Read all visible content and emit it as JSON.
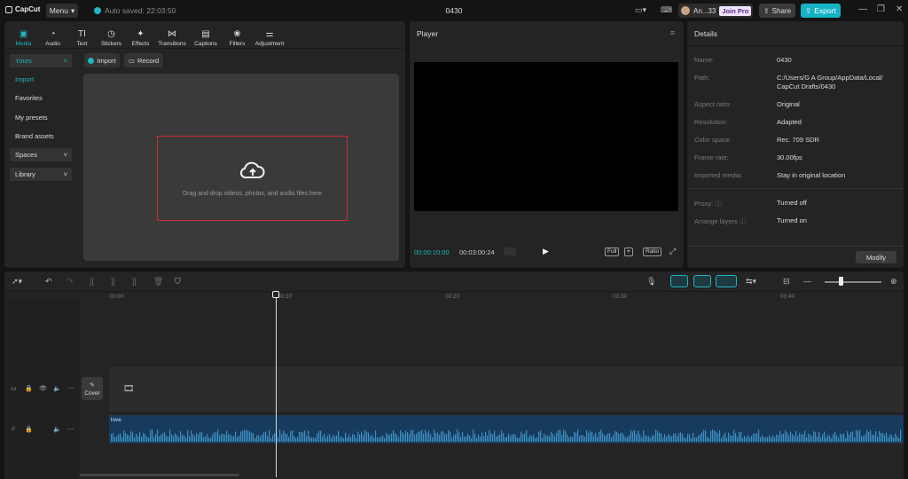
{
  "titlebar": {
    "app_name": "CapCut",
    "menu_label": "Menu",
    "autosave_text": "Auto saved: 22:03:50",
    "project_title": "0430",
    "user_name": "An...33",
    "join_pro": "Join Pro",
    "share_label": "Share",
    "export_label": "Export"
  },
  "media_tabs": [
    {
      "label": "Media",
      "icon": "media-icon"
    },
    {
      "label": "Audio",
      "icon": "audio-icon"
    },
    {
      "label": "Text",
      "icon": "text-icon"
    },
    {
      "label": "Stickers",
      "icon": "stickers-icon"
    },
    {
      "label": "Effects",
      "icon": "effects-icon"
    },
    {
      "label": "Transitions",
      "icon": "transitions-icon"
    },
    {
      "label": "Captions",
      "icon": "captions-icon"
    },
    {
      "label": "Filters",
      "icon": "filters-icon"
    },
    {
      "label": "Adjustment",
      "icon": "adjustment-icon"
    }
  ],
  "sidebar": {
    "yours": "Yours",
    "import": "Import",
    "favorites": "Favorites",
    "my_presets": "My presets",
    "brand_assets": "Brand assets",
    "spaces": "Spaces",
    "library": "Library"
  },
  "media": {
    "import_label": "Import",
    "record_label": "Record",
    "dropzone_text": "Drag and drop videos, photos, and audio files here"
  },
  "player": {
    "title": "Player",
    "current_time": "00:00:10:00",
    "total_time": "00:03:00:24",
    "full_label": "Full",
    "ratio_label": "Ratio"
  },
  "details": {
    "title": "Details",
    "rows": [
      {
        "key": "Name:",
        "value": "0430"
      },
      {
        "key": "Path:",
        "value": "C:/Users/G A Group/AppData/Local/ CapCut Drafts/0430"
      },
      {
        "key": "Aspect ratio:",
        "value": "Original"
      },
      {
        "key": "Resolution:",
        "value": "Adapted"
      },
      {
        "key": "Color space",
        "value": "Rec. 709 SDR"
      },
      {
        "key": "Frame rate:",
        "value": "30.00fps"
      },
      {
        "key": "Imported media:",
        "value": "Stay in original location"
      },
      {
        "key": "Proxy:",
        "value": "Turned off"
      },
      {
        "key": "Arrange layers",
        "value": "Turned on"
      }
    ],
    "modify_label": "Modify"
  },
  "timeline": {
    "ruler": [
      "00:00",
      "00:10",
      "00:20",
      "00:30",
      "00:40"
    ],
    "cover_label": "Cover",
    "audio_clip_label": "love"
  },
  "colors": {
    "accent": "#1fb5c2",
    "highlight_box": "#d32a2a",
    "audio_clip": "#173b5c"
  }
}
